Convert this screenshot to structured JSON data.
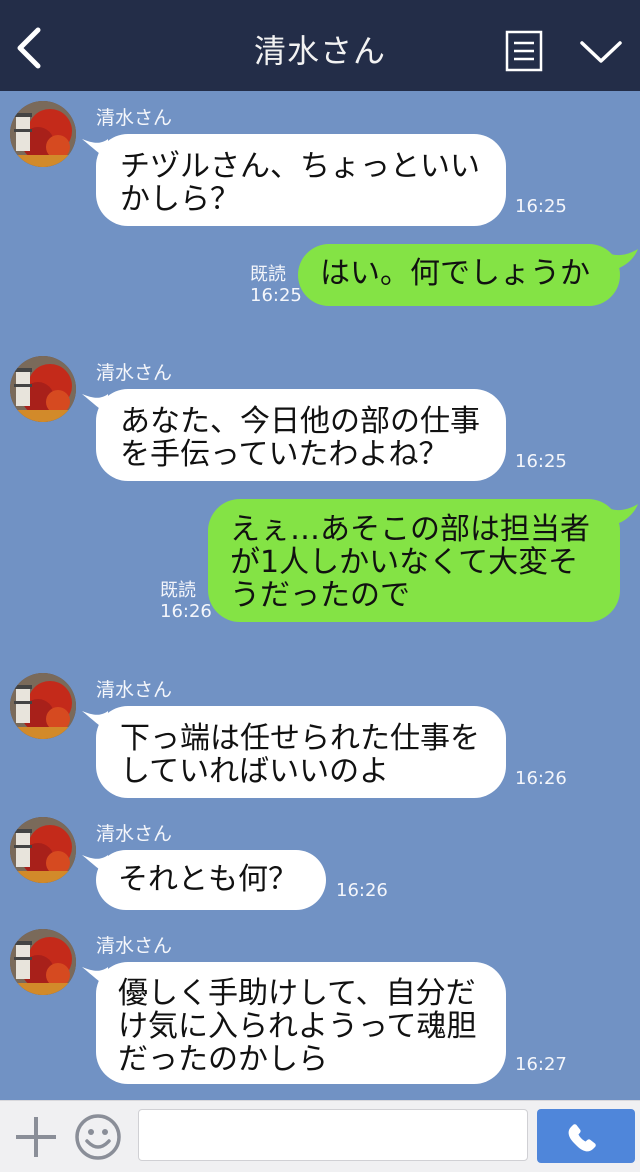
{
  "header": {
    "title": "清水さん",
    "icons": {
      "back": "chevron-left-icon",
      "menu": "menu-icon",
      "collapse": "chevron-down-icon"
    },
    "colors": {
      "background": "#232d48",
      "text": "#ffffff"
    }
  },
  "chat": {
    "background": "#7192c4",
    "messages": [
      {
        "side": "in",
        "sender": "清水さん",
        "text": "チヅルさん、ちょっといい\nかしら？",
        "time": "16:25"
      },
      {
        "side": "out",
        "read": "既読",
        "text": "はい。何でしょうか",
        "time": "16:25"
      },
      {
        "side": "in",
        "sender": "清水さん",
        "text": "あなた、今日他の部の仕事\nを手伝っていたわよね？",
        "time": "16:25"
      },
      {
        "side": "out",
        "read": "既読",
        "text": "えぇ…あそこの部は担当者\nが1人しかいなくて大変そ\nうだったので",
        "time": "16:26"
      },
      {
        "side": "in",
        "sender": "清水さん",
        "text": "下っ端は任せられた仕事を\nしていればいいのよ",
        "time": "16:26"
      },
      {
        "side": "in",
        "sender": "清水さん",
        "text": "それとも何？",
        "time": "16:26"
      },
      {
        "side": "in",
        "sender": "清水さん",
        "text": "優しく手助けして、自分だ\nけ気に入られようって魂胆\nだったのかしら",
        "time": "16:27"
      }
    ],
    "colors": {
      "incoming": "#ffffff",
      "outgoing": "#84e345"
    }
  },
  "inputbar": {
    "message_value": "",
    "icons": {
      "add": "plus-icon",
      "emoji": "smiley-icon",
      "call": "phone-icon"
    },
    "colors": {
      "call_button": "#4f86da"
    }
  }
}
